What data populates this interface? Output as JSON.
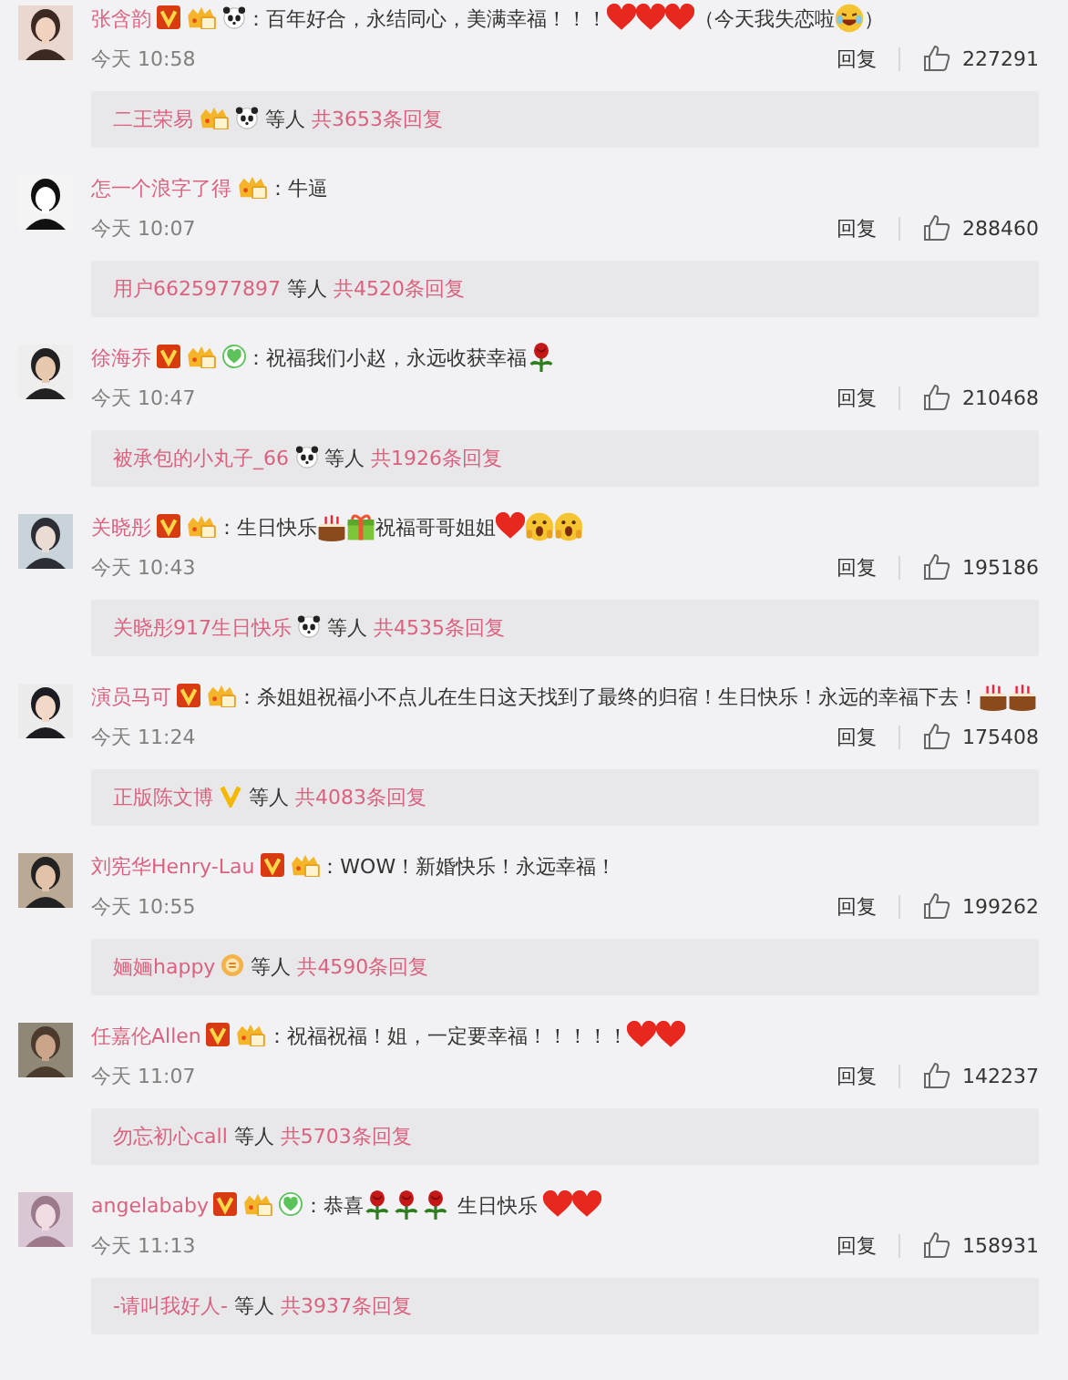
{
  "comments": [
    {
      "name": "张含韵",
      "badges": [
        {
          "kind": "verified"
        },
        {
          "kind": "vip"
        },
        {
          "kind": "panda"
        }
      ],
      "content": [
        {
          "kind": "text",
          "text": "：百年好合，永结同心，美满幸福！！！"
        },
        {
          "kind": "heart"
        },
        {
          "kind": "heart"
        },
        {
          "kind": "heart"
        },
        {
          "kind": "text",
          "text": "（今天我失恋啦"
        },
        {
          "kind": "laughing"
        },
        {
          "kind": "text",
          "text": "）"
        }
      ],
      "time": "今天 10:58",
      "reply": "回复",
      "likes": "227291",
      "thread": {
        "replier": "二王荣易",
        "replier_badges": [
          {
            "kind": "vip"
          },
          {
            "kind": "panda"
          }
        ],
        "others": "等人",
        "count": "共3653条回复"
      }
    },
    {
      "name": "怎一个浪字了得",
      "badges": [
        {
          "kind": "vip"
        }
      ],
      "content": [
        {
          "kind": "text",
          "text": "：牛逼"
        }
      ],
      "time": "今天 10:07",
      "reply": "回复",
      "likes": "288460",
      "thread": {
        "replier": "用户6625977897",
        "others": "等人",
        "count": "共4520条回复"
      }
    },
    {
      "name": "徐海乔",
      "badges": [
        {
          "kind": "verified"
        },
        {
          "kind": "vip"
        },
        {
          "kind": "green"
        }
      ],
      "content": [
        {
          "kind": "text",
          "text": "：祝福我们小赵，永远收获幸福"
        },
        {
          "kind": "rose"
        }
      ],
      "time": "今天 10:47",
      "reply": "回复",
      "likes": "210468",
      "thread": {
        "replier": "被承包的小丸子_66",
        "replier_badges": [
          {
            "kind": "panda"
          }
        ],
        "others": "等人",
        "count": "共1926条回复"
      }
    },
    {
      "name": "关晓彤",
      "badges": [
        {
          "kind": "verified"
        },
        {
          "kind": "vip"
        }
      ],
      "content": [
        {
          "kind": "text",
          "text": "：生日快乐"
        },
        {
          "kind": "cake"
        },
        {
          "kind": "gift"
        },
        {
          "kind": "text",
          "text": "祝福哥哥姐姐"
        },
        {
          "kind": "heart"
        },
        {
          "kind": "shocked"
        },
        {
          "kind": "shocked"
        }
      ],
      "time": "今天 10:43",
      "reply": "回复",
      "likes": "195186",
      "thread": {
        "replier": "关晓彤917生日快乐",
        "replier_badges": [
          {
            "kind": "panda"
          }
        ],
        "others": "等人",
        "count": "共4535条回复"
      }
    },
    {
      "name": "演员马可",
      "badges": [
        {
          "kind": "verified"
        },
        {
          "kind": "vip"
        }
      ],
      "content": [
        {
          "kind": "text",
          "text": "：杀姐姐祝福小不点儿在生日这天找到了最终的归宿！生日快乐！永远的幸福下去！"
        },
        {
          "kind": "cake"
        },
        {
          "kind": "cake"
        }
      ],
      "time": "今天 11:24",
      "reply": "回复",
      "likes": "175408",
      "thread": {
        "replier": "正版陈文博",
        "replier_badges": [
          {
            "kind": "yellow_v"
          }
        ],
        "others": "等人",
        "count": "共4083条回复"
      }
    },
    {
      "name": "刘宪华Henry-Lau",
      "badges": [
        {
          "kind": "verified"
        },
        {
          "kind": "vip"
        }
      ],
      "content": [
        {
          "kind": "text",
          "text": "：WOW！新婚快乐！永远幸福！"
        }
      ],
      "time": "今天 10:55",
      "reply": "回复",
      "likes": "199262",
      "thread": {
        "replier": "婳婳happy",
        "replier_badges": [
          {
            "kind": "medal"
          }
        ],
        "others": "等人",
        "count": "共4590条回复"
      }
    },
    {
      "name": "任嘉伦Allen",
      "badges": [
        {
          "kind": "verified"
        },
        {
          "kind": "vip"
        }
      ],
      "content": [
        {
          "kind": "text",
          "text": "：祝福祝福！姐，一定要幸福！！！！！"
        },
        {
          "kind": "heart"
        },
        {
          "kind": "heart"
        }
      ],
      "time": "今天 11:07",
      "reply": "回复",
      "likes": "142237",
      "thread": {
        "replier": "勿忘初心call",
        "others": "等人",
        "count": "共5703条回复"
      }
    },
    {
      "name": "angelababy",
      "badges": [
        {
          "kind": "verified"
        },
        {
          "kind": "vip"
        },
        {
          "kind": "green"
        }
      ],
      "content": [
        {
          "kind": "text",
          "text": "：恭喜"
        },
        {
          "kind": "rose"
        },
        {
          "kind": "rose"
        },
        {
          "kind": "rose"
        },
        {
          "kind": "text",
          "text": " 生日快乐 "
        },
        {
          "kind": "heart"
        },
        {
          "kind": "heart"
        }
      ],
      "time": "今天 11:13",
      "reply": "回复",
      "likes": "158931",
      "thread": {
        "replier": "-请叫我好人-",
        "others": "等人",
        "count": "共3937条回复"
      }
    }
  ]
}
